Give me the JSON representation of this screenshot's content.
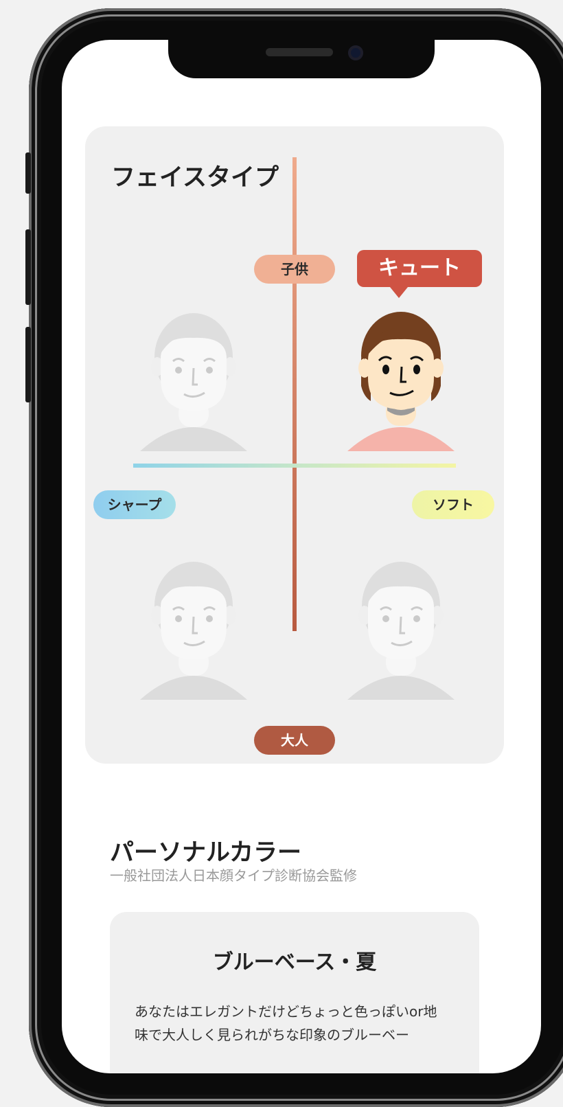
{
  "face_type": {
    "title": "フェイスタイプ",
    "axis": {
      "top": "子供",
      "bottom": "大人",
      "left": "シャープ",
      "right": "ソフト"
    },
    "result_label": "キュート",
    "quadrants": [
      {
        "position": "top-left",
        "active": false
      },
      {
        "position": "top-right",
        "active": true
      },
      {
        "position": "bottom-left",
        "active": false
      },
      {
        "position": "bottom-right",
        "active": false
      }
    ]
  },
  "personal_color": {
    "title": "パーソナルカラー",
    "subtitle": "一般社団法人日本顔タイプ診断協会監修",
    "result_title": "ブルーベース・夏",
    "description": "あなたはエレガントだけどちょっと色っぽいor地味で大人しく見られがちな印象のブルーベー"
  },
  "colors": {
    "accent": "#cf5343",
    "child": "#f0b094",
    "adult": "#b05a42",
    "sharp": "#8fcdee",
    "soft": "#f8f7a2",
    "hair": "#74401f",
    "skin": "#fde6c6",
    "shirt": "#f5b3aa"
  }
}
